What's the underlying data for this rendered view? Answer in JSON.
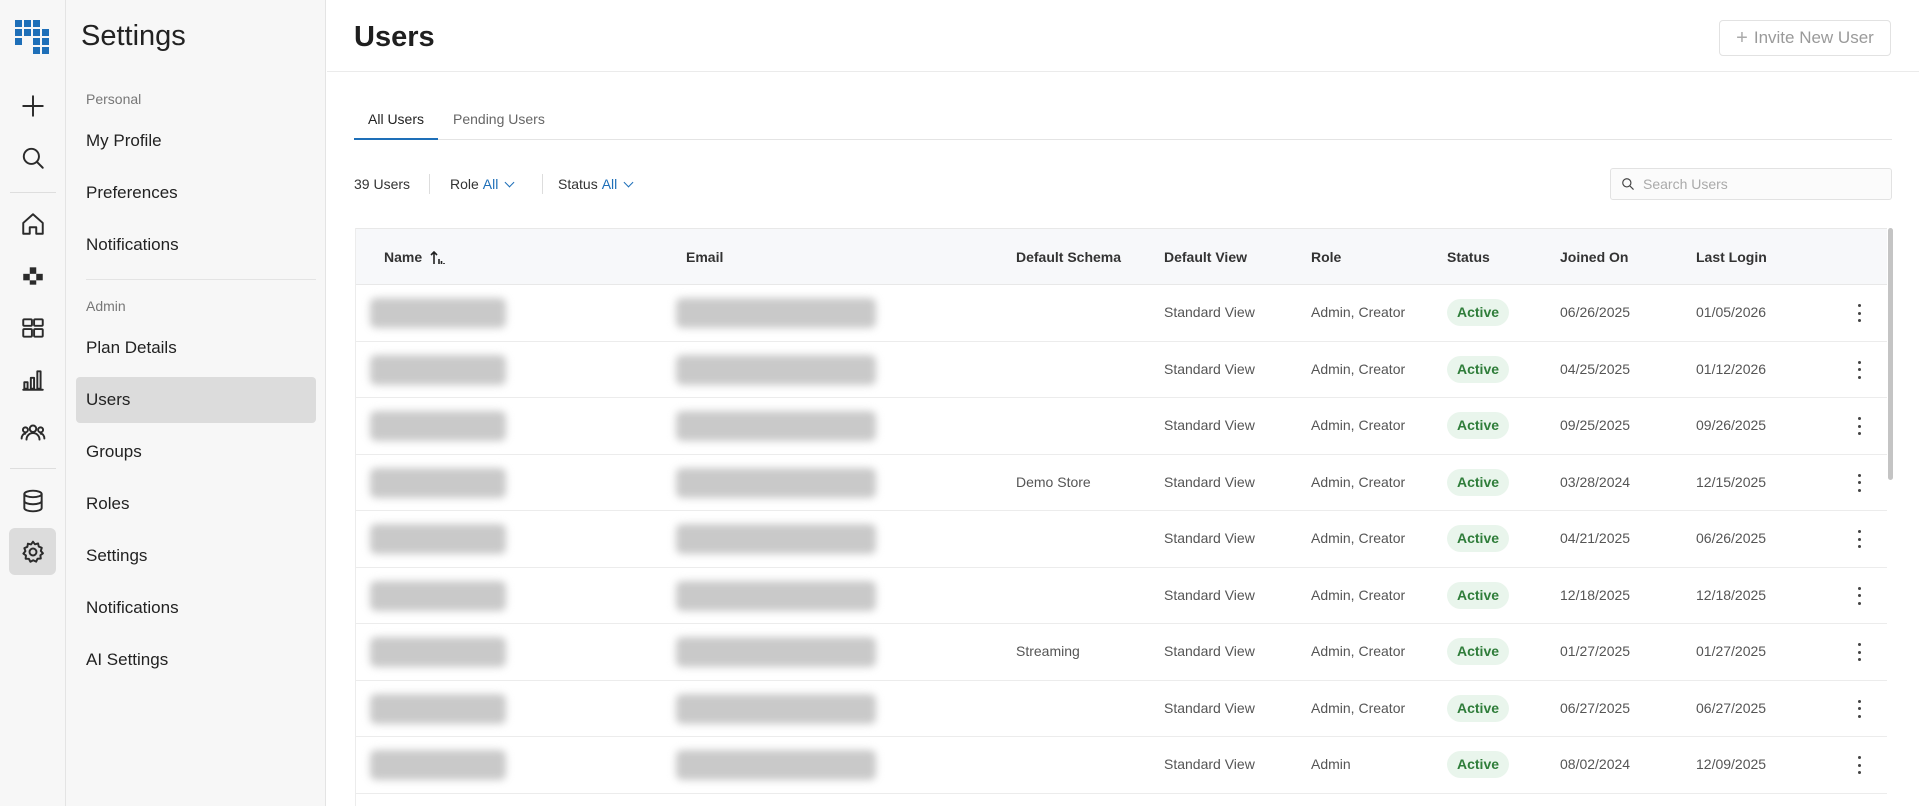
{
  "nav": {
    "title": "Settings",
    "personal_label": "Personal",
    "personal_items": [
      "My Profile",
      "Preferences",
      "Notifications"
    ],
    "admin_label": "Admin",
    "admin_items": [
      "Plan Details",
      "Users",
      "Groups",
      "Roles",
      "Settings",
      "Notifications",
      "AI Settings"
    ],
    "active_item": "Users"
  },
  "rail": {
    "icons": [
      "grid-logo-icon",
      "plus-icon",
      "search-icon",
      "home-icon",
      "pixel-blocks-icon",
      "dashboard-icon",
      "bar-chart-icon",
      "people-icon",
      "database-icon",
      "gear-icon"
    ],
    "active_icon": "gear-icon",
    "accent_color": "#1e6fb8"
  },
  "header": {
    "title": "Users",
    "invite_button": "Invite New User"
  },
  "tabs": [
    {
      "label": "All Users",
      "active": true
    },
    {
      "label": "Pending Users",
      "active": false
    }
  ],
  "filters": {
    "count": "39 Users",
    "role_label": "Role",
    "role_value": "All",
    "status_label": "Status",
    "status_value": "All",
    "search_placeholder": "Search Users"
  },
  "table": {
    "columns": [
      "Name",
      "Email",
      "Default Schema",
      "Default View",
      "Role",
      "Status",
      "Joined On",
      "Last Login"
    ],
    "rows": [
      {
        "schema": "",
        "view": "Standard View",
        "role": "Admin, Creator",
        "status": "Active",
        "joined": "06/26/2025",
        "last_login": "01/05/2026"
      },
      {
        "schema": "",
        "view": "Standard View",
        "role": "Admin, Creator",
        "status": "Active",
        "joined": "04/25/2025",
        "last_login": "01/12/2026"
      },
      {
        "schema": "",
        "view": "Standard View",
        "role": "Admin, Creator",
        "status": "Active",
        "joined": "09/25/2025",
        "last_login": "09/26/2025"
      },
      {
        "schema": "Demo Store",
        "view": "Standard View",
        "role": "Admin, Creator",
        "status": "Active",
        "joined": "03/28/2024",
        "last_login": "12/15/2025"
      },
      {
        "schema": "",
        "view": "Standard View",
        "role": "Admin, Creator",
        "status": "Active",
        "joined": "04/21/2025",
        "last_login": "06/26/2025"
      },
      {
        "schema": "",
        "view": "Standard View",
        "role": "Admin, Creator",
        "status": "Active",
        "joined": "12/18/2025",
        "last_login": "12/18/2025"
      },
      {
        "schema": "Streaming",
        "view": "Standard View",
        "role": "Admin, Creator",
        "status": "Active",
        "joined": "01/27/2025",
        "last_login": "01/27/2025"
      },
      {
        "schema": "",
        "view": "Standard View",
        "role": "Admin, Creator",
        "status": "Active",
        "joined": "06/27/2025",
        "last_login": "06/27/2025"
      },
      {
        "schema": "",
        "view": "Standard View",
        "role": "Admin",
        "status": "Active",
        "joined": "08/02/2024",
        "last_login": "12/09/2025"
      }
    ]
  },
  "colors": {
    "status_active_bg": "#e9f5ec",
    "status_active_text": "#2f7d3a",
    "link": "#1e6fb8"
  }
}
